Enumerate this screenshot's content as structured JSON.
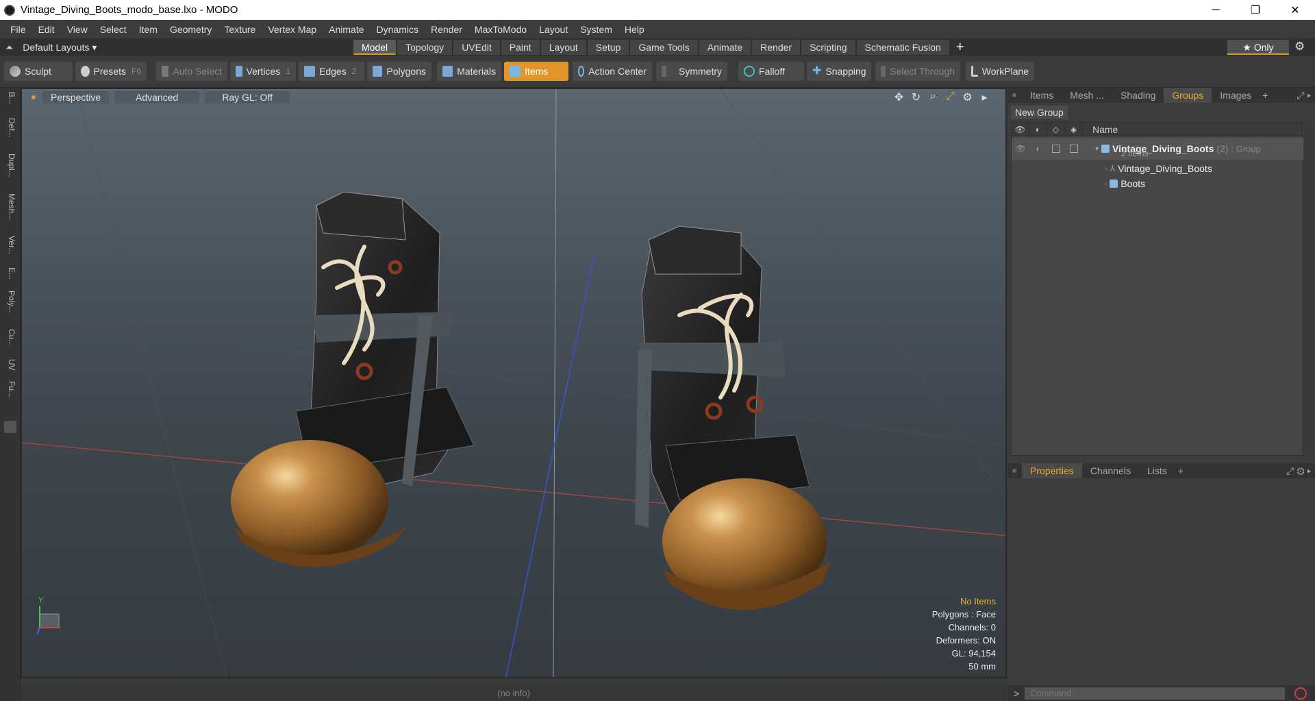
{
  "window": {
    "title": "Vintage_Diving_Boots_modo_base.lxo - MODO",
    "minimize": "─",
    "maximize": "❐",
    "close": "✕"
  },
  "menu": [
    "File",
    "Edit",
    "View",
    "Select",
    "Item",
    "Geometry",
    "Texture",
    "Vertex Map",
    "Animate",
    "Dynamics",
    "Render",
    "MaxToModo",
    "Layout",
    "System",
    "Help"
  ],
  "layouts": {
    "label": "Default Layouts ▾"
  },
  "tabs": [
    "Model",
    "Topology",
    "UVEdit",
    "Paint",
    "Layout",
    "Setup",
    "Game Tools",
    "Animate",
    "Render",
    "Scripting",
    "Schematic Fusion"
  ],
  "active_tab": "Model",
  "only_label": "★ Only",
  "toolbar": {
    "sculpt": "Sculpt",
    "presets": "Presets",
    "presets_key": "F6",
    "auto_select": "Auto Select",
    "vertices": "Vertices",
    "vertices_key": "1",
    "edges": "Edges",
    "edges_key": "2",
    "polygons": "Polygons",
    "materials": "Materials",
    "items": "Items",
    "action_center": "Action Center",
    "symmetry": "Symmetry",
    "falloff": "Falloff",
    "snapping": "Snapping",
    "select_through": "Select Through",
    "workplane": "WorkPlane"
  },
  "left_strip": [
    "B...",
    "Def...",
    "Dupl...",
    "Mesh...",
    "Ver...",
    "E...",
    "Poly...",
    "Cu...",
    "UV",
    "Fu..."
  ],
  "viewport": {
    "perspective": "Perspective",
    "advanced": "Advanced",
    "raygl": "Ray GL: Off",
    "info": {
      "items": "No Items",
      "polygons": "Polygons : Face",
      "channels": "Channels: 0",
      "deformers": "Deformers: ON",
      "gl": "GL: 94,154",
      "scale": "50 mm"
    },
    "axis_y": "Y"
  },
  "status": "(no info)",
  "top_tabs": [
    "Items",
    "Mesh ...",
    "Shading",
    "Groups",
    "Images"
  ],
  "active_top_tab": "Groups",
  "new_group": "New Group",
  "tree": {
    "name_header": "Name",
    "group_name": "Vintage_Diving_Boots",
    "group_count": "(2)",
    "group_type": ": Group",
    "group_items": "2 Items",
    "children": [
      "Vintage_Diving_Boots",
      "Boots"
    ]
  },
  "bottom_tabs": [
    "Properties",
    "Channels",
    "Lists"
  ],
  "active_bottom_tab": "Properties",
  "command": {
    "prompt": ">",
    "placeholder": "Command"
  }
}
